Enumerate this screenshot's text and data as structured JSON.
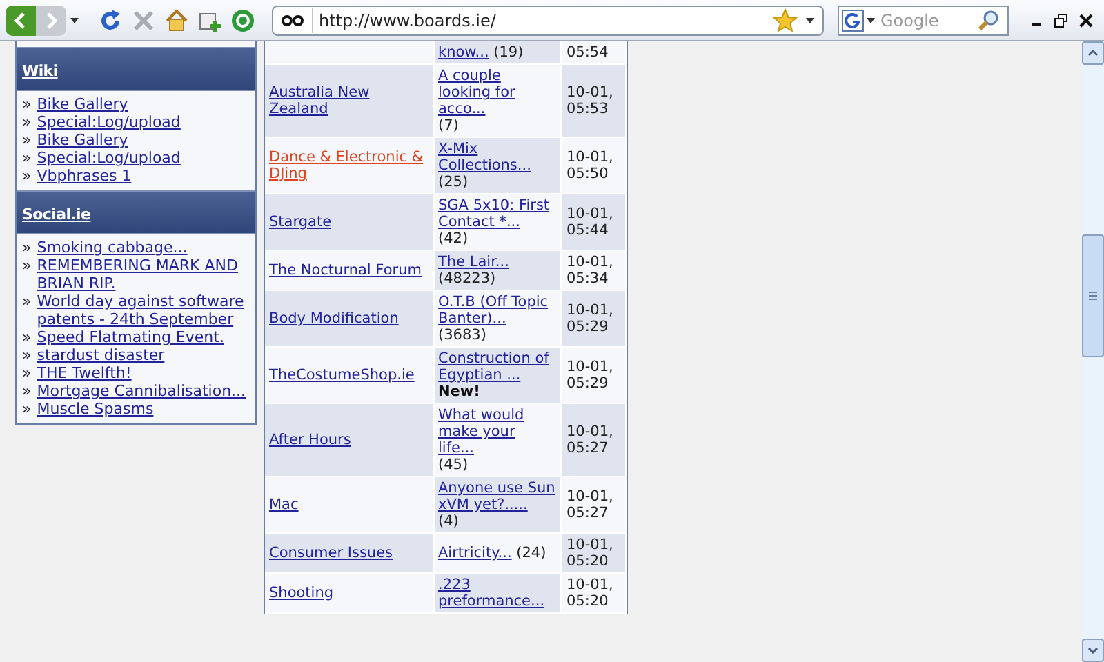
{
  "toolbar": {
    "address": "http://www.boards.ie/",
    "search": {
      "placeholder": "Google"
    }
  },
  "sidebar": {
    "sections": [
      {
        "title": "Wiki",
        "items": [
          {
            "marker": "»",
            "text": "Bike Gallery"
          },
          {
            "marker": "»",
            "text": "Special:Log/upload"
          },
          {
            "marker": "»",
            "text": "Bike Gallery"
          },
          {
            "marker": "»",
            "text": "Special:Log/upload"
          },
          {
            "marker": "»",
            "text": "Vbphrases 1"
          }
        ]
      },
      {
        "title": "Social.ie",
        "items": [
          {
            "marker": "»",
            "text": "Smoking cabbage..."
          },
          {
            "marker": "»",
            "text": "REMEMBERING MARK AND BRIAN RIP."
          },
          {
            "marker": "»",
            "text": "World day against software patents - 24th September"
          },
          {
            "marker": "»",
            "text": "Speed Flatmating Event."
          },
          {
            "marker": "»",
            "text": "stardust disaster"
          },
          {
            "marker": "»",
            "text": "THE Twelfth!"
          },
          {
            "marker": "»",
            "text": "Mortgage Cannibalisation..."
          },
          {
            "marker": "»",
            "text": "Muscle Spasms"
          }
        ]
      }
    ]
  },
  "table": {
    "rows": [
      {
        "thread": "know...",
        "count": "(19)",
        "time": "05:54"
      },
      {
        "forum": "Australia New Zealand",
        "active": false,
        "thread": "A couple looking for acco...",
        "count": "(7)",
        "date": "10-01,",
        "time": "05:53"
      },
      {
        "forum": "Dance & Electronic & DJing",
        "active": true,
        "thread": "X-Mix Collections...",
        "count": "(25)",
        "date": "10-01,",
        "time": "05:50"
      },
      {
        "forum": "Stargate",
        "active": false,
        "thread": "SGA 5x10: First Contact *...",
        "count": "(42)",
        "date": "10-01,",
        "time": "05:44"
      },
      {
        "forum": "The Nocturnal Forum",
        "active": false,
        "thread": "The Lair...",
        "count": "(48223)",
        "date": "10-01,",
        "time": "05:34"
      },
      {
        "forum": "Body Modification",
        "active": false,
        "thread": "O.T.B (Off Topic Banter)...",
        "count": "(3683)",
        "date": "10-01,",
        "time": "05:29"
      },
      {
        "forum": "TheCostumeShop.ie",
        "active": false,
        "thread": "Construction of Egyptian ...",
        "new_label": "New!",
        "date": "10-01,",
        "time": "05:29"
      },
      {
        "forum": "After Hours",
        "active": false,
        "thread": "What would make your life...",
        "count": "(45)",
        "date": "10-01,",
        "time": "05:27"
      },
      {
        "forum": "Mac",
        "active": false,
        "thread": "Anyone use Sun xVM yet?.....",
        "count": "(4)",
        "date": "10-01,",
        "time": "05:27"
      },
      {
        "forum": "Consumer Issues",
        "active": false,
        "thread": "Airtricity...",
        "count": "(24)",
        "date": "10-01,",
        "time": "05:20"
      },
      {
        "forum": "Shooting",
        "active": false,
        "thread": ".223 preformance...",
        "date": "10-01,",
        "time": "05:20"
      }
    ]
  }
}
